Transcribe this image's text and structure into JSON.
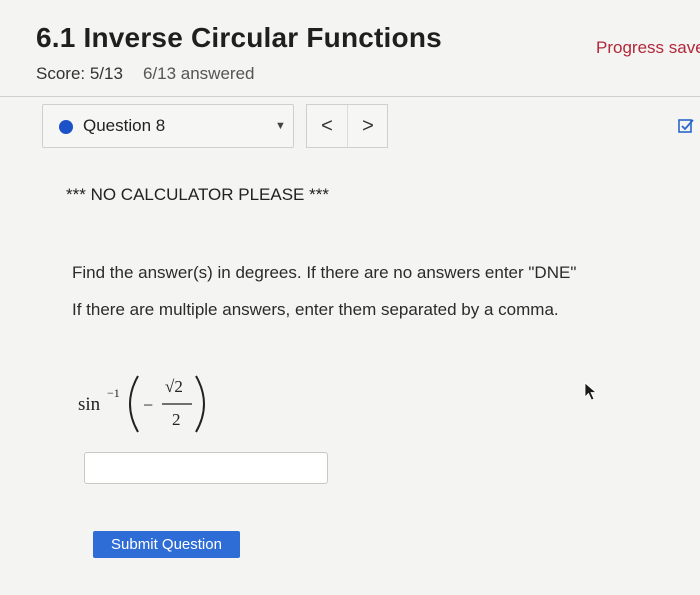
{
  "header": {
    "title": "6.1 Inverse Circular Functions",
    "progress_label": "Progress save",
    "score": "Score: 5/13",
    "answered": "6/13 answered"
  },
  "question_nav": {
    "selected": "Question 8",
    "prev_symbol": "<",
    "next_symbol": ">"
  },
  "body": {
    "notice": "*** NO CALCULATOR PLEASE ***",
    "instructions": [
      "Find the answer(s) in degrees.  If there are no answers enter \"DNE\"",
      "If there are multiple answers, enter them separated by a comma."
    ],
    "expression": {
      "func": "sin",
      "exponent": "−1",
      "sign": "−",
      "numerator": "√2",
      "denominator": "2"
    },
    "answer_value": "",
    "submit_label": "Submit Question"
  },
  "colors": {
    "accent": "#2f6dd6",
    "progress_text": "#b2283a",
    "question_dot": "#1c52c7"
  }
}
